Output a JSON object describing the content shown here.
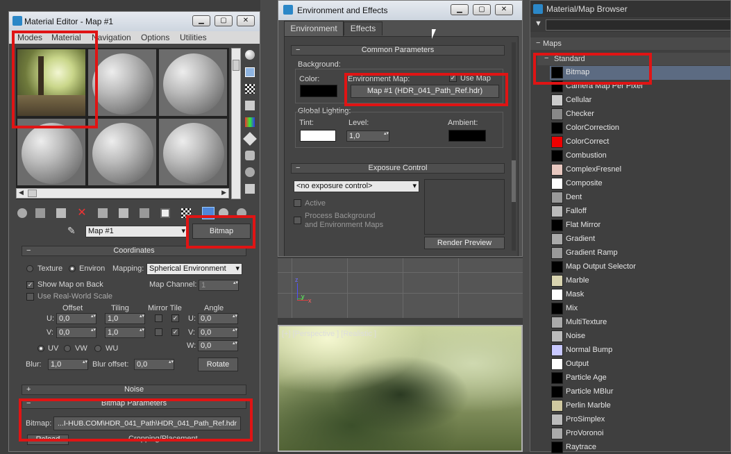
{
  "material_editor": {
    "title": "Material Editor - Map #1",
    "menu": [
      "Modes",
      "Material",
      "Navigation",
      "Options",
      "Utilities"
    ],
    "map_name": "Map #1",
    "map_type_button": "Bitmap",
    "coordinates": {
      "header": "Coordinates",
      "texture_label": "Texture",
      "environ_label": "Environ",
      "mapping_label": "Mapping:",
      "mapping_value": "Spherical Environment",
      "show_map_on_back": "Show Map on Back",
      "map_channel_label": "Map Channel:",
      "map_channel_value": "1",
      "use_real_world_scale": "Use Real-World Scale",
      "offset_header": "Offset",
      "tiling_header": "Tiling",
      "mirror_tile_header": "Mirror Tile",
      "angle_header": "Angle",
      "u_label": "U:",
      "v_label": "V:",
      "w_label": "W:",
      "offset_u": "0,0",
      "offset_v": "0,0",
      "tiling_u": "1,0",
      "tiling_v": "1,0",
      "angle_u": "0,0",
      "angle_v": "0,0",
      "angle_w": "0,0",
      "uv_label": "UV",
      "vw_label": "VW",
      "wu_label": "WU",
      "blur_label": "Blur:",
      "blur_value": "1,0",
      "blur_offset_label": "Blur offset:",
      "blur_offset_value": "0,0",
      "rotate_button": "Rotate"
    },
    "noise_header": "Noise",
    "bitmap_params_header": "Bitmap Parameters",
    "bitmap_label": "Bitmap:",
    "bitmap_path": "...I-HUB.COM\\HDR_041_Path\\HDR_041_Path_Ref.hdr",
    "reload_button": "Reload",
    "cropping_label": "Cropping/Placement"
  },
  "environment": {
    "title": "Environment and Effects",
    "tabs": [
      "Environment",
      "Effects"
    ],
    "common_params_header": "Common Parameters",
    "background_label": "Background:",
    "color_label": "Color:",
    "env_map_label": "Environment Map:",
    "use_map_label": "Use Map",
    "env_map_button": "Map #1 (HDR_041_Path_Ref.hdr)",
    "global_lighting_label": "Global Lighting:",
    "tint_label": "Tint:",
    "level_label": "Level:",
    "level_value": "1,0",
    "ambient_label": "Ambient:",
    "exposure_header": "Exposure Control",
    "exposure_dropdown": "<no exposure control>",
    "active_label": "Active",
    "process_bg_label_1": "Process Background",
    "process_bg_label_2": "and Environment Maps",
    "render_preview_button": "Render Preview"
  },
  "viewport": {
    "label": "[+] [Perspective ] [Realistic ]",
    "axis_z": "z",
    "axis_x": "x",
    "axis_y": "y"
  },
  "browser": {
    "title": "Material/Map Browser",
    "maps_header": "Maps",
    "standard_header": "Standard",
    "items": [
      {
        "name": "Bitmap",
        "color": "#000000"
      },
      {
        "name": "Camera Map Per Pixel",
        "color": "#000000"
      },
      {
        "name": "Cellular",
        "color": "#cccccc"
      },
      {
        "name": "Checker",
        "color": "#888888"
      },
      {
        "name": "ColorCorrection",
        "color": "#000000"
      },
      {
        "name": "ColorCorrect",
        "color": "#ee0000"
      },
      {
        "name": "Combustion",
        "color": "#000000"
      },
      {
        "name": "ComplexFresnel",
        "color": "#e8c8c0"
      },
      {
        "name": "Composite",
        "color": "#ffffff"
      },
      {
        "name": "Dent",
        "color": "#999999"
      },
      {
        "name": "Falloff",
        "color": "#bbbbbb"
      },
      {
        "name": "Flat Mirror",
        "color": "#000000"
      },
      {
        "name": "Gradient",
        "color": "#aaaaaa"
      },
      {
        "name": "Gradient Ramp",
        "color": "#999999"
      },
      {
        "name": "Map Output Selector",
        "color": "#000000"
      },
      {
        "name": "Marble",
        "color": "#d9d4b0"
      },
      {
        "name": "Mask",
        "color": "#ffffff"
      },
      {
        "name": "Mix",
        "color": "#000000"
      },
      {
        "name": "MultiTexture",
        "color": "#aaaaaa"
      },
      {
        "name": "Noise",
        "color": "#bbbbbb"
      },
      {
        "name": "Normal Bump",
        "color": "#c8c8ff"
      },
      {
        "name": "Output",
        "color": "#ffffff"
      },
      {
        "name": "Particle Age",
        "color": "#000000"
      },
      {
        "name": "Particle MBlur",
        "color": "#000000"
      },
      {
        "name": "Perlin Marble",
        "color": "#cfc8a0"
      },
      {
        "name": "ProSimplex",
        "color": "#bbbbbb"
      },
      {
        "name": "ProVoronoi",
        "color": "#aaaaaa"
      },
      {
        "name": "Raytrace",
        "color": "#000000"
      }
    ]
  }
}
